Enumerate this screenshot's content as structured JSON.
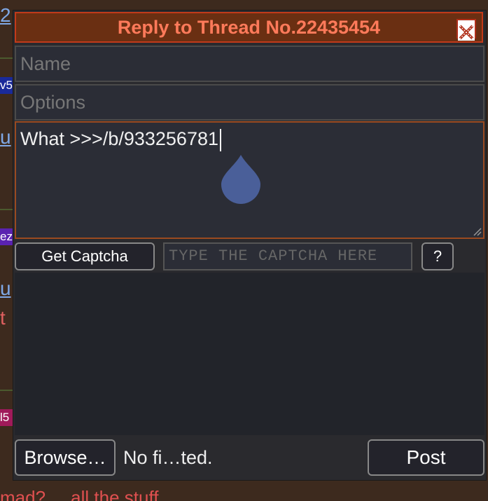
{
  "background": {
    "top_fragment": "2",
    "tag1": "v5",
    "link1": "u",
    "tag2": "ez",
    "link2": "u",
    "red_char": "t",
    "tag3": "l5",
    "bottom_text": "mad? ... all the stuff"
  },
  "reply_window": {
    "title": "Reply to Thread No.22435454",
    "name_placeholder": "Name",
    "options_placeholder": "Options",
    "comment_value": "What >>>/b/933256781",
    "captcha_button": "Get Captcha",
    "captcha_placeholder": "TYPE THE CAPTCHA HERE",
    "help_button": "?",
    "browse_button": "Browse…",
    "file_status": "No fi…ted.",
    "post_button": "Post"
  },
  "colors": {
    "title_bar": "#6a2f12",
    "title_text": "#ff7a5a",
    "comment_border": "#9a4a20",
    "caret_drop": "#4a5f99"
  }
}
